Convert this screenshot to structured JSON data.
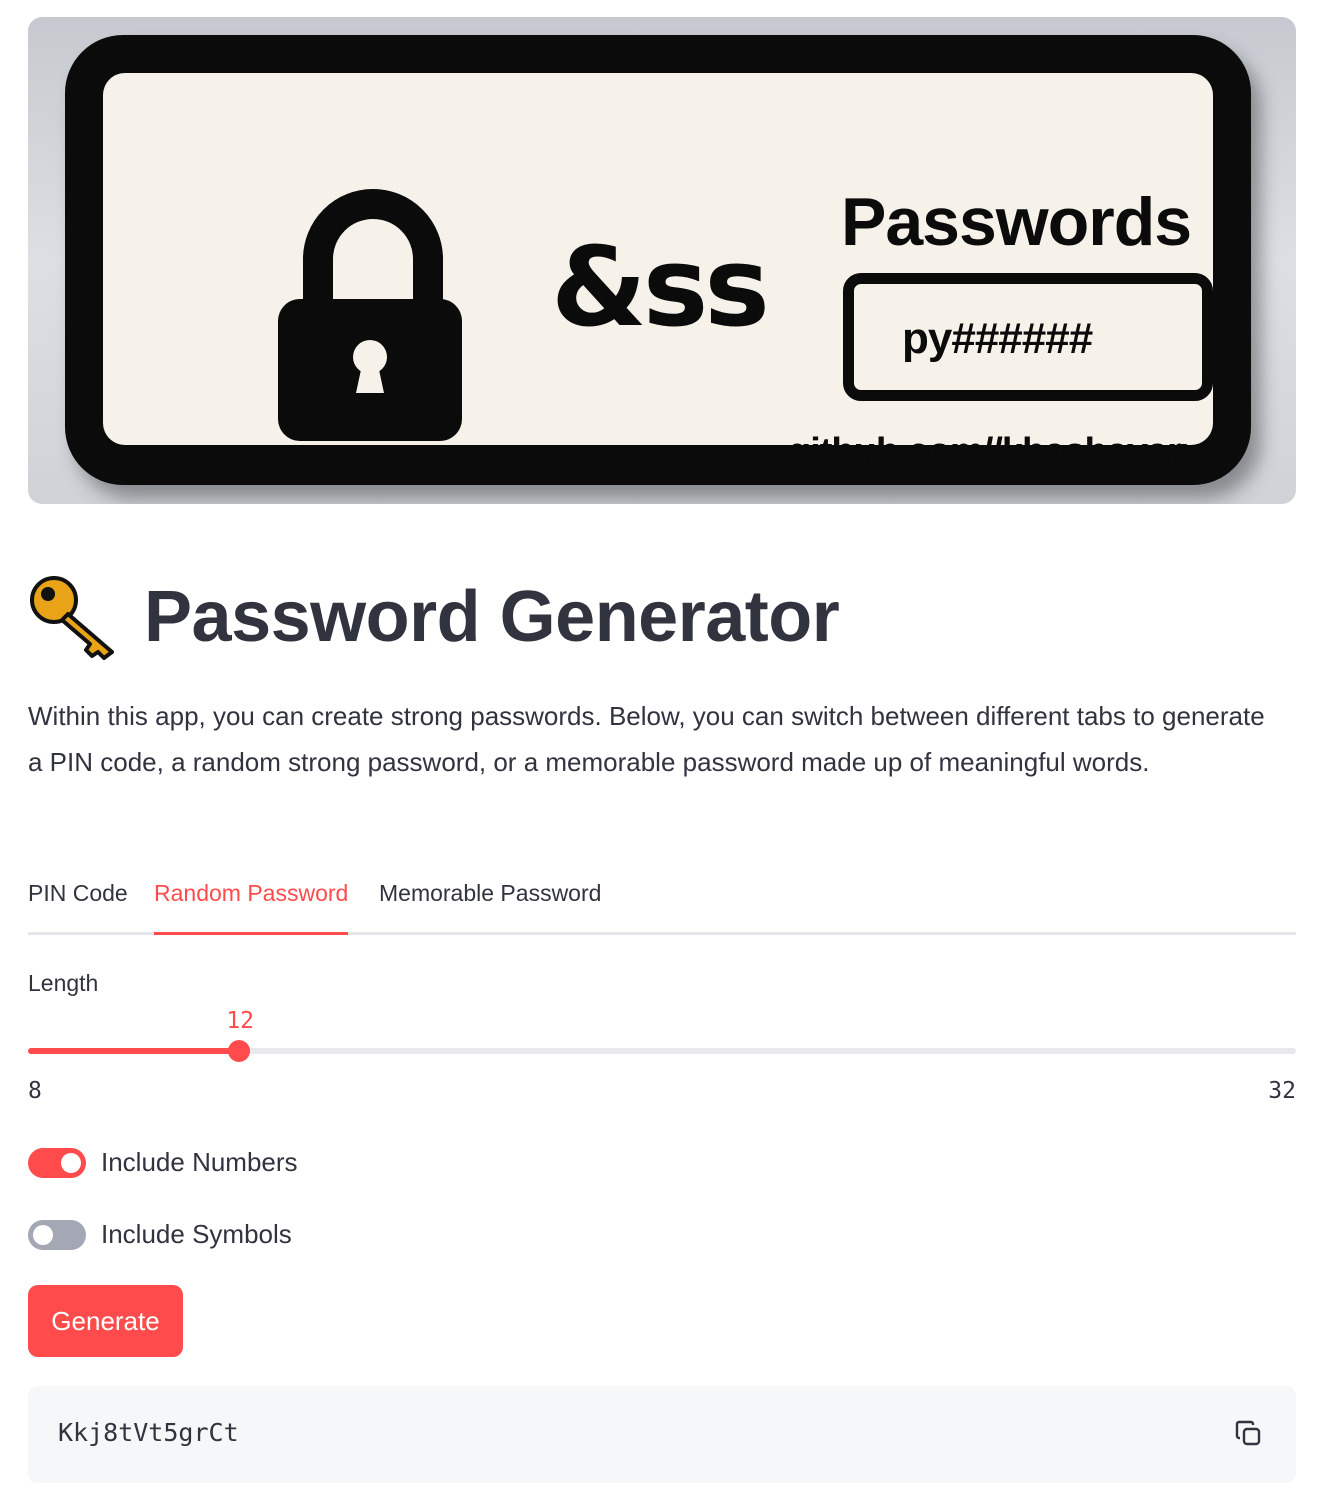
{
  "banner": {
    "title": "Passwords",
    "symbol": "&ss",
    "field_text": "py######",
    "url": "github.com//khashayaryr"
  },
  "header": {
    "icon": "key-icon",
    "title": "Password Generator"
  },
  "intro": "Within this app, you can create strong passwords. Below, you can switch between different tabs to generate a PIN code, a random strong password, or a memorable password made up of meaningful words.",
  "tabs": [
    {
      "label": "PIN Code",
      "active": false
    },
    {
      "label": "Random Password",
      "active": true
    },
    {
      "label": "Memorable Password",
      "active": false
    }
  ],
  "slider": {
    "label": "Length",
    "value": 12,
    "value_text": "12",
    "min": 8,
    "min_text": "8",
    "max": 32,
    "max_text": "32"
  },
  "toggles": [
    {
      "label": "Include Numbers",
      "checked": true
    },
    {
      "label": "Include Symbols",
      "checked": false
    }
  ],
  "generate_label": "Generate",
  "output": {
    "password": "Kkj8tVt5grCt",
    "copy_icon": "copy-icon"
  },
  "colors": {
    "accent": "#ff4b4b",
    "text": "#31333f",
    "toggle_off": "#a3a8b4",
    "code_bg": "#f6f7f9"
  }
}
